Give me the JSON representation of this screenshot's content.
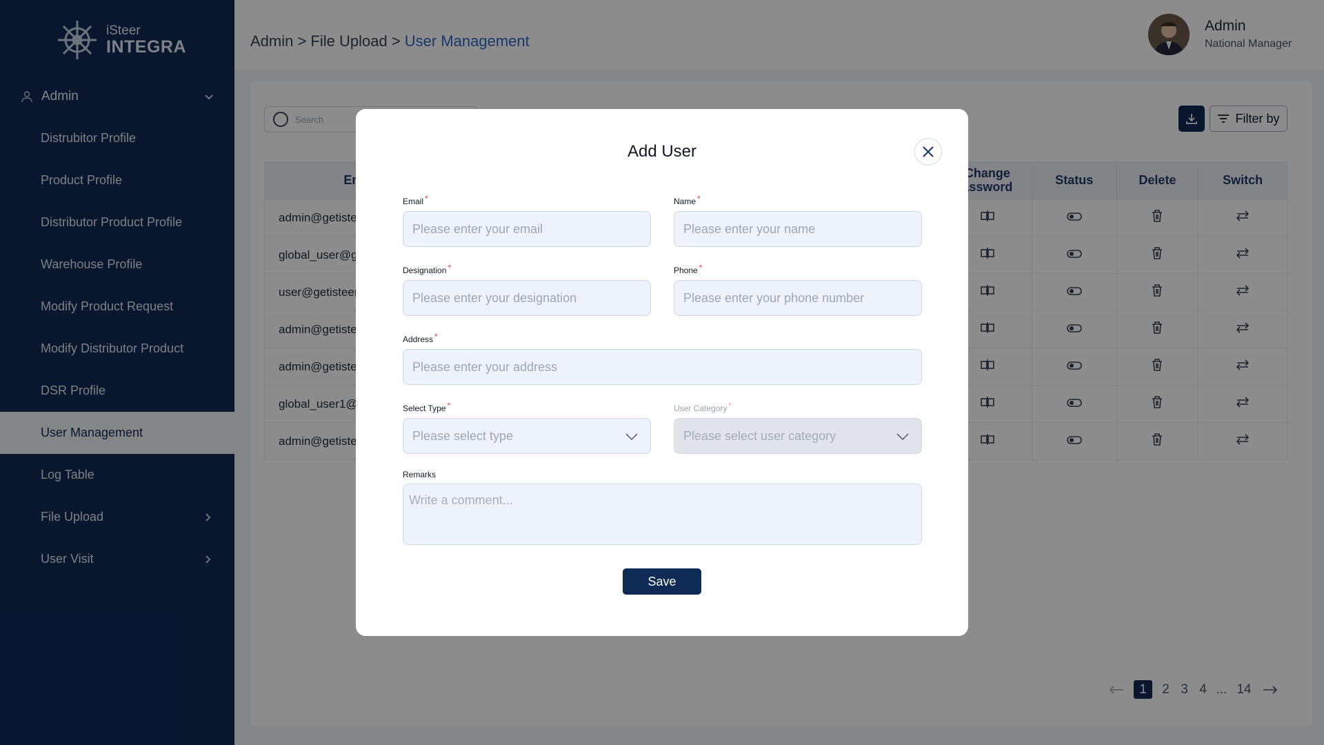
{
  "brand": {
    "line1": "iSteer",
    "line2": "INTEGRA"
  },
  "sidebar": {
    "group": {
      "label": "Admin"
    },
    "items": [
      {
        "label": "Distrubitor Profile"
      },
      {
        "label": "Product Profile"
      },
      {
        "label": "Distributor Product Profile"
      },
      {
        "label": "Warehouse Profile"
      },
      {
        "label": "Modify Product Request"
      },
      {
        "label": "Modify Distributor Product"
      },
      {
        "label": "DSR Profile"
      },
      {
        "label": "User Management"
      },
      {
        "label": "Log Table"
      },
      {
        "label": "File Upload"
      },
      {
        "label": "User Visit"
      }
    ]
  },
  "header": {
    "breadcrumb_root": "Admin > File Upload > ",
    "breadcrumb_current": "User Management",
    "user_name": "Admin",
    "user_role": "National Manager"
  },
  "toolbar": {
    "search_placeholder": "Search",
    "filter_label": "Filter by"
  },
  "table": {
    "headers": {
      "email": "Em",
      "change_password": "Change\nassword",
      "status": "Status",
      "delete": "Delete",
      "switch": "Switch"
    },
    "rows": [
      {
        "email": "admin@getiste"
      },
      {
        "email": "global_user@g"
      },
      {
        "email": "user@getisteer"
      },
      {
        "email": "admin@getiste"
      },
      {
        "email": "admin@getiste"
      },
      {
        "email": "global_user1@"
      },
      {
        "email": "admin@getiste"
      }
    ]
  },
  "pagination": {
    "pages": [
      "1",
      "2",
      "3",
      "4",
      "...",
      "14"
    ],
    "current": "1"
  },
  "modal": {
    "title": "Add User",
    "email": {
      "label": "Email",
      "placeholder": "Please enter your email"
    },
    "name": {
      "label": "Name",
      "placeholder": "Please enter your name"
    },
    "designation": {
      "label": "Designation",
      "placeholder": "Please enter your designation"
    },
    "phone": {
      "label": "Phone",
      "placeholder": "Please enter your phone number"
    },
    "address": {
      "label": "Address",
      "placeholder": "Please enter your address"
    },
    "select_type": {
      "label": "Select Type",
      "placeholder": "Please select type"
    },
    "user_category": {
      "label": "User Category",
      "placeholder": "Please select user category"
    },
    "remarks": {
      "label": "Remarks",
      "placeholder": "Write a comment..."
    },
    "required_mark": "*",
    "save_label": "Save"
  },
  "colors": {
    "brand_navy": "#0f2a55",
    "breadcrumb_accent": "#2d66c3",
    "required": "#e53e3e"
  }
}
